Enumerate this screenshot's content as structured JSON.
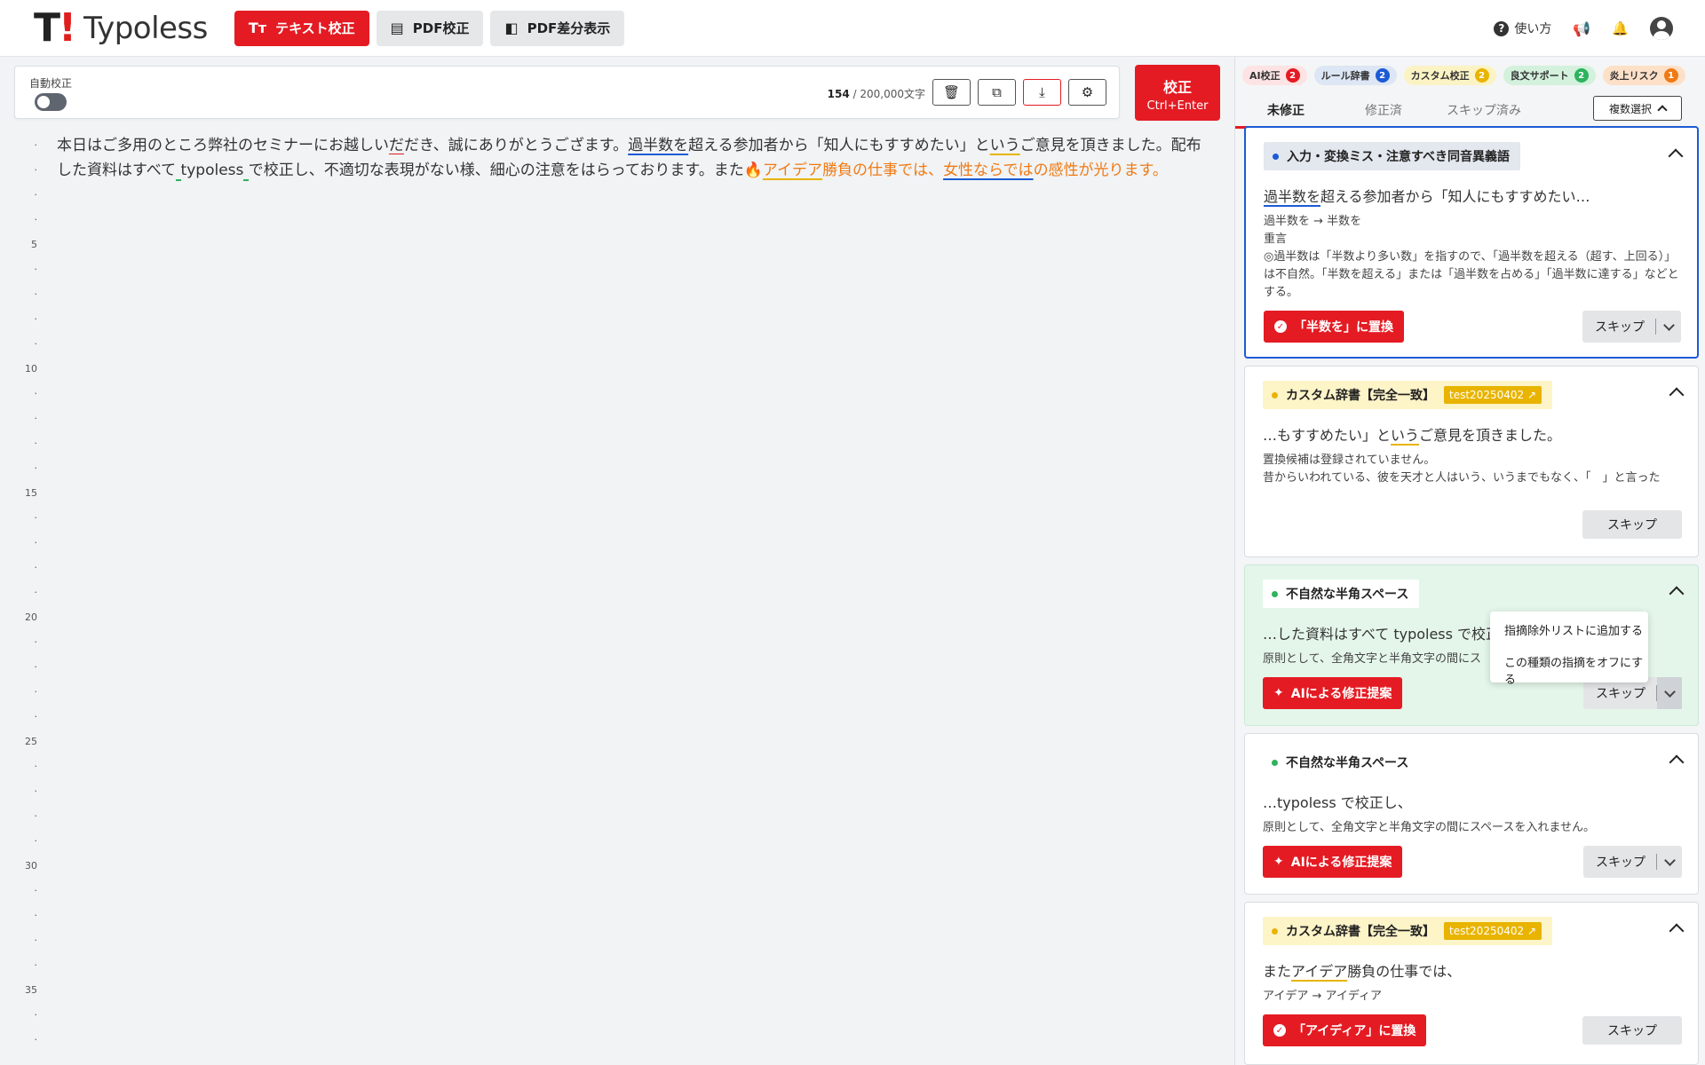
{
  "header": {
    "logo_mark": "T!",
    "logo_text": "Typoless",
    "nav": [
      {
        "label": "テキスト校正",
        "icon": "text-icon"
      },
      {
        "label": "PDF校正",
        "icon": "document-icon"
      },
      {
        "label": "PDF差分表示",
        "icon": "compare-icon"
      }
    ],
    "help_label": "使い方"
  },
  "toolbar": {
    "auto_label": "自動校正",
    "char_count": "154",
    "char_limit": "/ 200,000文字",
    "run_label": "校正",
    "run_shortcut": "Ctrl+Enter"
  },
  "gutter": {
    "numbers": [
      "5",
      "10",
      "15",
      "20",
      "25",
      "30",
      "35"
    ]
  },
  "editor": {
    "segments": [
      {
        "t": "本日はご多用のところ弊社のセミナーにお越しい",
        "c": ""
      },
      {
        "t": "だ",
        "c": "u-red"
      },
      {
        "t": "だき、誠にありがとうご",
        "c": ""
      },
      {
        "t": "ざ",
        "c": ""
      },
      {
        "t": "ます。",
        "c": ""
      },
      {
        "t": "過半数を",
        "c": "u-blue"
      },
      {
        "t": "超える参加者から「知人にもすすめたい」と",
        "c": ""
      },
      {
        "t": "いう",
        "c": "u-yellow"
      },
      {
        "t": "ご意見を頂きました。配布した資料はすべて",
        "c": ""
      },
      {
        "t": " ",
        "c": "u-green"
      },
      {
        "t": "typoless",
        "c": ""
      },
      {
        "t": " ",
        "c": "u-green"
      },
      {
        "t": "で校正し、不適切な表現がない様、細心の注意をはらっております。また",
        "c": ""
      },
      {
        "t": "🔥",
        "c": "orange"
      },
      {
        "t": "アイデア",
        "c": "orange u-yellow"
      },
      {
        "t": "勝負の仕事では、",
        "c": "orange"
      },
      {
        "t": "女性ならでは",
        "c": "orange u-blue"
      },
      {
        "t": "の感性が光ります。",
        "c": "orange"
      }
    ]
  },
  "panel": {
    "categories": [
      {
        "label": "AI校正",
        "count": "2",
        "bg": "#fde3e3",
        "cnt_bg": "#e41b23"
      },
      {
        "label": "ルール辞書",
        "count": "2",
        "bg": "#dde6f4",
        "cnt_bg": "#1c5bd4"
      },
      {
        "label": "カスタム校正",
        "count": "2",
        "bg": "#fcf3c5",
        "cnt_bg": "#e8b400"
      },
      {
        "label": "良文サポート",
        "count": "2",
        "bg": "#d3f1dc",
        "cnt_bg": "#2db35d"
      },
      {
        "label": "炎上リスク",
        "count": "1",
        "bg": "#fde0c8",
        "cnt_bg": "#f07a14"
      }
    ],
    "tabs": [
      "未修正",
      "修正済",
      "スキップ済み"
    ],
    "multi_select": "複数選択",
    "cards": [
      {
        "tag": "入力・変換ミス・注意すべき同音異義語",
        "excerpt_hl": "過半数を",
        "excerpt_rest": "超える参加者から「知人にもすすめたい…",
        "details": [
          "過半数を → 半数を",
          "重言",
          "◎過半数は「半数より多い数」を指すので、「過半数を超える（超す、上回る）」は不自然。「半数を超える」または「過半数を占める」「過半数に達する」などとする。"
        ],
        "action": "「半数を」に置換",
        "skip": "スキップ"
      },
      {
        "tag": "カスタム辞書【完全一致】",
        "ext": "test20250402",
        "excerpt_pre": "…もすすめたい」と",
        "excerpt_hl": "いう",
        "excerpt_rest": "ご意見を頂きました。",
        "details": [
          "置換候補は登録されていません。",
          "昔からいわれている、彼を天才と人はいう、いうまでもなく、「　」と言った"
        ],
        "skip": "スキップ"
      },
      {
        "tag": "不自然な半角スペース",
        "excerpt": "…した資料はすべて typoless で校正",
        "detail": "原則として、全角文字と半角文字の間にス",
        "action": "AIによる修正提案",
        "skip": "スキップ"
      },
      {
        "tag": "不自然な半角スペース",
        "excerpt": "…typoless で校正し、",
        "detail": "原則として、全角文字と半角文字の間にスペースを入れません。",
        "action": "AIによる修正提案",
        "skip": "スキップ"
      },
      {
        "tag": "カスタム辞書【完全一致】",
        "ext": "test20250402",
        "excerpt_pre": "また",
        "excerpt_hl": "アイデア",
        "excerpt_rest": "勝負の仕事では、",
        "detail": "アイデア → アイディア",
        "action": "「アイディア」に置換",
        "skip": "スキップ"
      }
    ],
    "dropdown": [
      "指摘除外リストに追加する",
      "この種類の指摘をオフにする"
    ]
  }
}
